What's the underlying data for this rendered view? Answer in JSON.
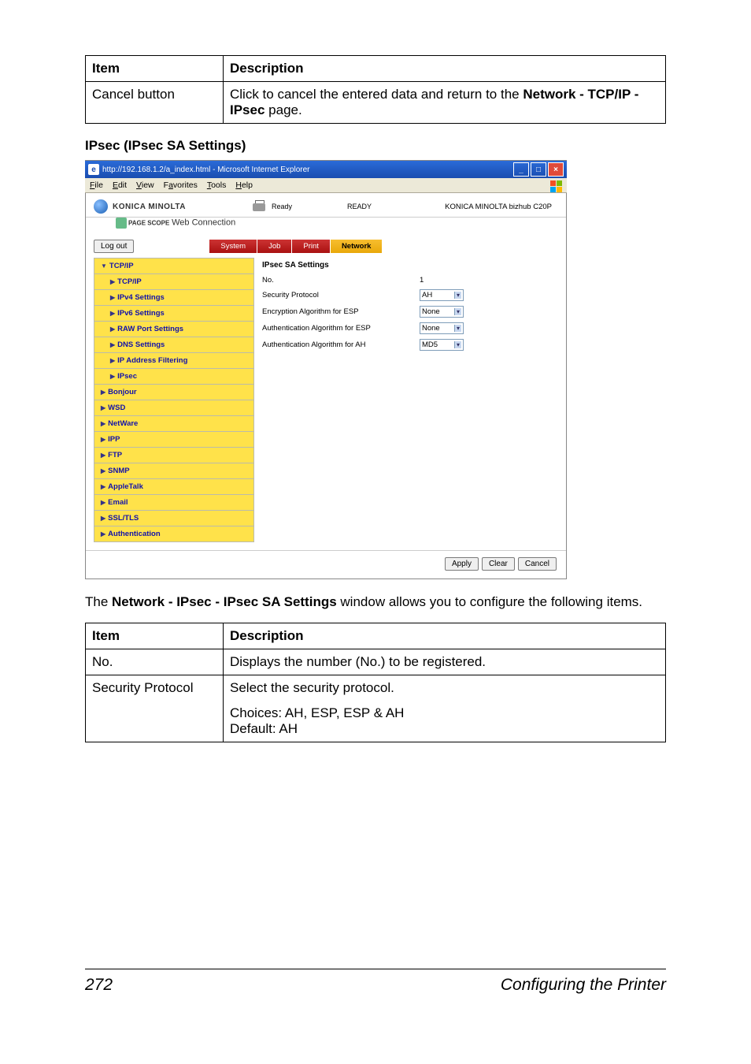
{
  "table1": {
    "head_item": "Item",
    "head_desc": "Description",
    "row_item": "Cancel button",
    "row_desc_1": "Click to cancel the entered data and return to the ",
    "row_desc_bold": "Network - TCP/IP - IPsec",
    "row_desc_2": " page."
  },
  "section_heading": "IPsec (IPsec SA Settings)",
  "screenshot": {
    "window_title": "http://192.168.1.2/a_index.html - Microsoft Internet Explorer",
    "menu": {
      "file": "File",
      "edit": "Edit",
      "view": "View",
      "favorites": "Favorites",
      "tools": "Tools",
      "help": "Help"
    },
    "brand": "KONICA MINOLTA",
    "pagescope_small": "PAGE SCOPE",
    "pagescope_label": "Web Connection",
    "status_ready": "Ready",
    "ready_caps": "READY",
    "model": "KONICA MINOLTA bizhub C20P",
    "logout": "Log out",
    "tabs": {
      "system": "System",
      "job": "Job",
      "print": "Print",
      "network": "Network"
    },
    "sidebar": {
      "tcpip_top": "TCP/IP",
      "tcpip": "TCP/IP",
      "ipv4": "IPv4 Settings",
      "ipv6": "IPv6 Settings",
      "raw": "RAW Port Settings",
      "dns": "DNS Settings",
      "ipfilter": "IP Address Filtering",
      "ipsec": "IPsec",
      "bonjour": "Bonjour",
      "wsd": "WSD",
      "netware": "NetWare",
      "ipp": "IPP",
      "ftp": "FTP",
      "snmp": "SNMP",
      "appletalk": "AppleTalk",
      "email": "Email",
      "ssltls": "SSL/TLS",
      "auth": "Authentication"
    },
    "panel": {
      "title": "IPsec SA Settings",
      "no_label": "No.",
      "no_value": "1",
      "sec_proto_label": "Security Protocol",
      "sec_proto_value": "AH",
      "enc_esp_label": "Encryption Algorithm for ESP",
      "enc_esp_value": "None",
      "auth_esp_label": "Authentication Algorithm for ESP",
      "auth_esp_value": "None",
      "auth_ah_label": "Authentication Algorithm for AH",
      "auth_ah_value": "MD5"
    },
    "buttons": {
      "apply": "Apply",
      "clear": "Clear",
      "cancel": "Cancel"
    }
  },
  "body_text_1": "The ",
  "body_text_bold": "Network - IPsec - IPsec SA Settings",
  "body_text_2": " window allows you to configure the following items.",
  "table2": {
    "head_item": "Item",
    "head_desc": "Description",
    "r1_item": "No.",
    "r1_desc": "Displays the number (No.) to be registered.",
    "r2_item": "Security Protocol",
    "r2_desc_1": "Select the security protocol.",
    "r2_desc_2a": "Choices: AH, ESP, ESP & AH",
    "r2_desc_2b": "Default:  AH"
  },
  "footer": {
    "page": "272",
    "title": "Configuring the Printer"
  }
}
